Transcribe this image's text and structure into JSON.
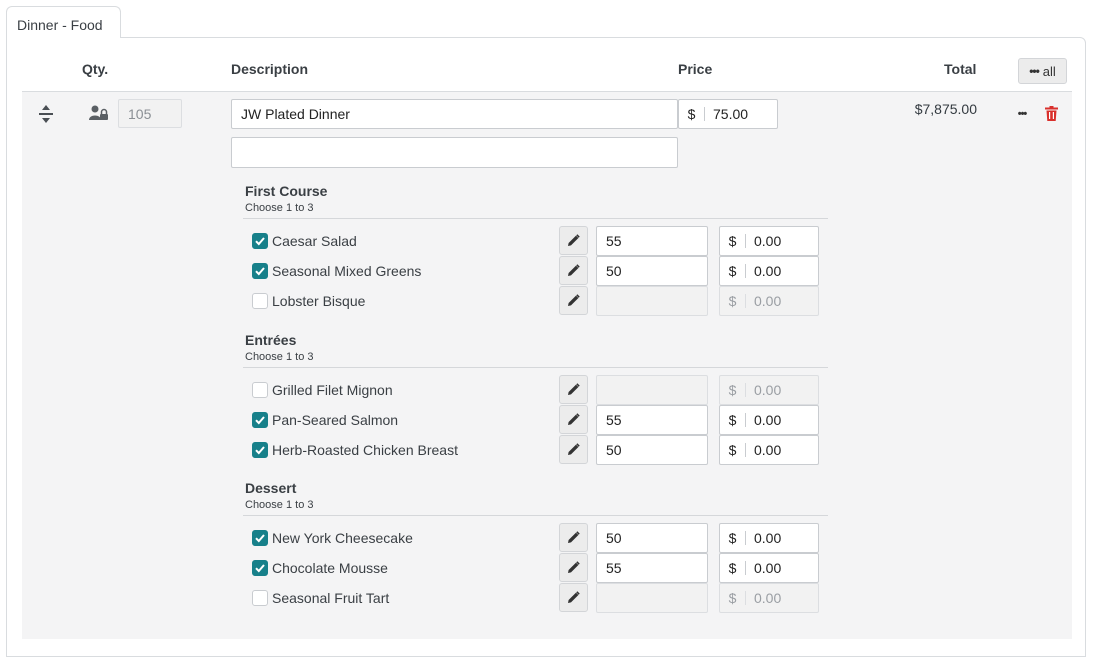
{
  "tab": {
    "label": "Dinner - Food"
  },
  "header": {
    "qty": "Qty.",
    "description": "Description",
    "price": "Price",
    "total": "Total",
    "all_button": "all"
  },
  "item": {
    "qty": "105",
    "description": "JW Plated Dinner",
    "description_note": "",
    "currency": "$",
    "price": "75.00",
    "total": "$7,875.00"
  },
  "sections": [
    {
      "title": "First Course",
      "subtitle": "Choose 1 to 3",
      "options": [
        {
          "label": "Caesar Salad",
          "checked": true,
          "qty": "55",
          "currency": "$",
          "price": "0.00"
        },
        {
          "label": "Seasonal Mixed Greens",
          "checked": true,
          "qty": "50",
          "currency": "$",
          "price": "0.00"
        },
        {
          "label": "Lobster Bisque",
          "checked": false,
          "qty": "",
          "currency": "$",
          "price": "0.00"
        }
      ]
    },
    {
      "title": "Entrées",
      "subtitle": "Choose 1 to 3",
      "options": [
        {
          "label": "Grilled Filet Mignon",
          "checked": false,
          "qty": "",
          "currency": "$",
          "price": "0.00"
        },
        {
          "label": "Pan-Seared Salmon",
          "checked": true,
          "qty": "55",
          "currency": "$",
          "price": "0.00"
        },
        {
          "label": "Herb-Roasted Chicken Breast",
          "checked": true,
          "qty": "50",
          "currency": "$",
          "price": "0.00"
        }
      ]
    },
    {
      "title": "Dessert",
      "subtitle": "Choose 1 to 3",
      "options": [
        {
          "label": "New York Cheesecake",
          "checked": true,
          "qty": "50",
          "currency": "$",
          "price": "0.00"
        },
        {
          "label": "Chocolate Mousse",
          "checked": true,
          "qty": "55",
          "currency": "$",
          "price": "0.00"
        },
        {
          "label": "Seasonal Fruit Tart",
          "checked": false,
          "qty": "",
          "currency": "$",
          "price": "0.00"
        }
      ]
    }
  ],
  "colors": {
    "accent": "#17808a",
    "delete": "#d9302c",
    "row_bg": "#f4f4f5"
  },
  "icons": [
    "drag-handle-icon",
    "user-lock-icon",
    "more-icon",
    "trash-icon",
    "pencil-icon",
    "checkmark-icon"
  ]
}
